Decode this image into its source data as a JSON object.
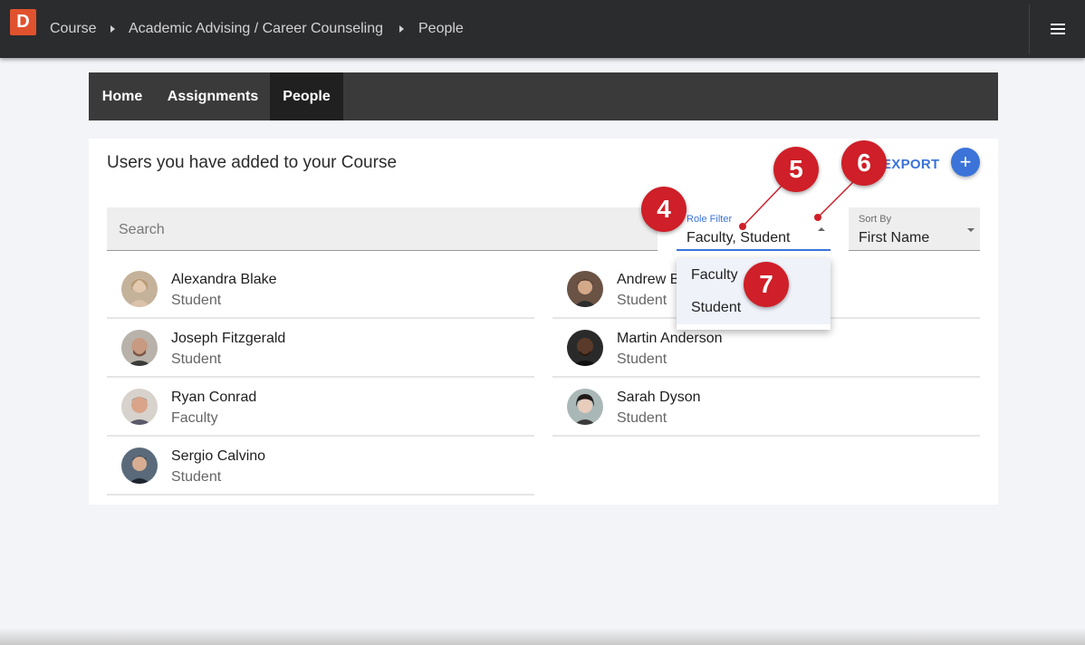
{
  "topbar": {
    "logo_text": "D",
    "breadcrumbs": [
      "Course",
      "Academic Advising / Career Counseling",
      "People"
    ],
    "menu_icon": "hamburger-icon"
  },
  "tabs": [
    {
      "label": "Home",
      "active": false
    },
    {
      "label": "Assignments",
      "active": false
    },
    {
      "label": "People",
      "active": true
    }
  ],
  "main": {
    "title": "Users you have added to your Course",
    "export_label": "EXPORT",
    "add_label": "+",
    "search_placeholder": "Search",
    "role_filter": {
      "label": "Role Filter",
      "value": "Faculty, Student",
      "options": [
        "Faculty",
        "Student"
      ]
    },
    "sort_by": {
      "label": "Sort By",
      "value": "First Name"
    }
  },
  "people": [
    {
      "name": "Alexandra Blake",
      "role": "Student"
    },
    {
      "name": "Andrew B",
      "role": "Student"
    },
    {
      "name": "Joseph Fitzgerald",
      "role": "Student"
    },
    {
      "name": "Martin Anderson",
      "role": "Student"
    },
    {
      "name": "Ryan Conrad",
      "role": "Faculty"
    },
    {
      "name": "Sarah Dyson",
      "role": "Student"
    },
    {
      "name": "Sergio Calvino",
      "role": "Student"
    }
  ],
  "callouts": [
    "4",
    "5",
    "6",
    "7"
  ],
  "colors": {
    "topbar": "#2b2c2e",
    "accent_blue": "#3b73d9",
    "logo_orange": "#e0522e",
    "callout_red": "#cf1f28"
  }
}
